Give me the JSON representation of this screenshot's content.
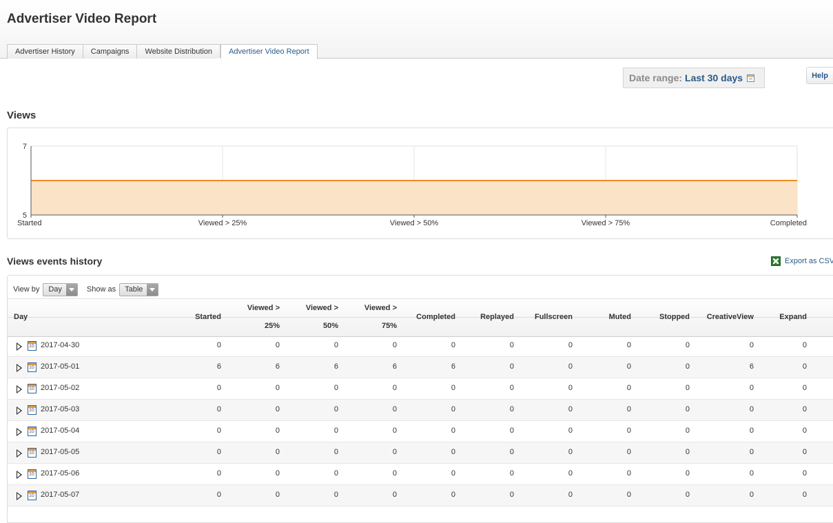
{
  "page": {
    "title": "Advertiser Video Report"
  },
  "tabs": [
    {
      "label": "Advertiser History",
      "active": false
    },
    {
      "label": "Campaigns",
      "active": false
    },
    {
      "label": "Website Distribution",
      "active": false
    },
    {
      "label": "Advertiser Video Report",
      "active": true
    }
  ],
  "date_range": {
    "label": "Date range:",
    "value": "Last 30 days",
    "icon": "calendar-icon"
  },
  "help": {
    "label": "Help"
  },
  "views_section": {
    "title": "Views"
  },
  "chart_data": {
    "type": "area",
    "title": "",
    "xlabel": "",
    "ylabel": "",
    "categories": [
      "Started",
      "Viewed > 25%",
      "Viewed > 50%",
      "Viewed > 75%",
      "Completed"
    ],
    "series": [
      {
        "values": [
          6,
          6,
          6,
          6,
          6
        ]
      }
    ],
    "ylim": [
      5,
      7
    ],
    "yticks": [
      "7",
      "5"
    ],
    "grid": true,
    "line_color": "#f08a24",
    "fill_color": "#fbe3c8"
  },
  "history_section": {
    "title": "Views events history"
  },
  "export": {
    "label": "Export as CSV",
    "icon": "excel-icon"
  },
  "controls": {
    "view_by_label": "View by",
    "view_by_value": "Day",
    "show_as_label": "Show as",
    "show_as_value": "Table"
  },
  "table": {
    "day_header": "Day",
    "headers": [
      {
        "line1": "Started",
        "line2": ""
      },
      {
        "line1": "Viewed >",
        "line2": "25%"
      },
      {
        "line1": "Viewed >",
        "line2": "50%"
      },
      {
        "line1": "Viewed >",
        "line2": "75%"
      },
      {
        "line1": "Completed",
        "line2": ""
      },
      {
        "line1": "Replayed",
        "line2": ""
      },
      {
        "line1": "Fullscreen",
        "line2": ""
      },
      {
        "line1": "Muted",
        "line2": ""
      },
      {
        "line1": "Stopped",
        "line2": ""
      },
      {
        "line1": "CreativeView",
        "line2": ""
      },
      {
        "line1": "Expand",
        "line2": ""
      }
    ],
    "rows": [
      {
        "day": "2017-04-30",
        "values": [
          "0",
          "0",
          "0",
          "0",
          "0",
          "0",
          "0",
          "0",
          "0",
          "0",
          "0"
        ]
      },
      {
        "day": "2017-05-01",
        "values": [
          "6",
          "6",
          "6",
          "6",
          "6",
          "0",
          "0",
          "0",
          "0",
          "6",
          "0"
        ]
      },
      {
        "day": "2017-05-02",
        "values": [
          "0",
          "0",
          "0",
          "0",
          "0",
          "0",
          "0",
          "0",
          "0",
          "0",
          "0"
        ]
      },
      {
        "day": "2017-05-03",
        "values": [
          "0",
          "0",
          "0",
          "0",
          "0",
          "0",
          "0",
          "0",
          "0",
          "0",
          "0"
        ]
      },
      {
        "day": "2017-05-04",
        "values": [
          "0",
          "0",
          "0",
          "0",
          "0",
          "0",
          "0",
          "0",
          "0",
          "0",
          "0"
        ]
      },
      {
        "day": "2017-05-05",
        "values": [
          "0",
          "0",
          "0",
          "0",
          "0",
          "0",
          "0",
          "0",
          "0",
          "0",
          "0"
        ]
      },
      {
        "day": "2017-05-06",
        "values": [
          "0",
          "0",
          "0",
          "0",
          "0",
          "0",
          "0",
          "0",
          "0",
          "0",
          "0"
        ]
      },
      {
        "day": "2017-05-07",
        "values": [
          "0",
          "0",
          "0",
          "0",
          "0",
          "0",
          "0",
          "0",
          "0",
          "0",
          "0"
        ]
      }
    ]
  }
}
